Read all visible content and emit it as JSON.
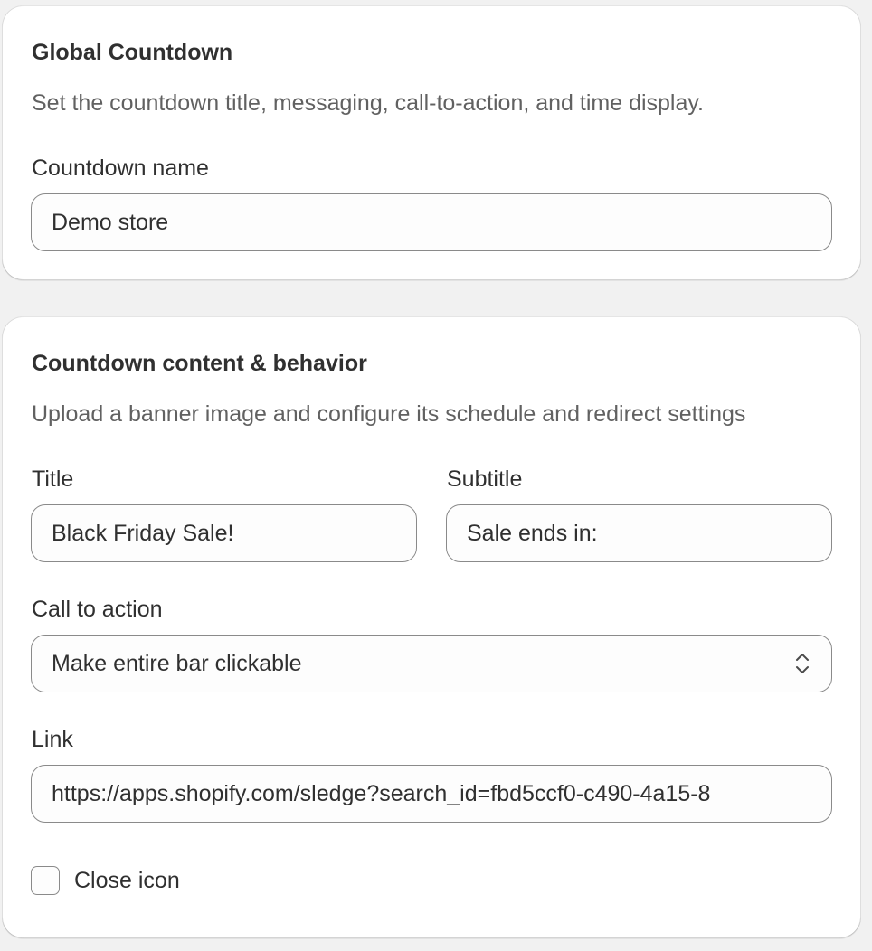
{
  "global_card": {
    "title": "Global Countdown",
    "description": "Set the countdown title, messaging, call-to-action, and time display.",
    "name_label": "Countdown name",
    "name_value": "Demo store"
  },
  "content_card": {
    "title": "Countdown content & behavior",
    "description": "Upload a banner image and configure its schedule and redirect settings",
    "title_label": "Title",
    "title_value": "Black Friday Sale!",
    "subtitle_label": "Subtitle",
    "subtitle_value": "Sale ends in:",
    "cta_label": "Call to action",
    "cta_value": "Make entire bar clickable",
    "cta_icon": "select-chevrons-icon",
    "link_label": "Link",
    "link_value": "https://apps.shopify.com/sledge?search_id=fbd5ccf0-c490-4a15-8",
    "close_icon_label": "Close icon",
    "close_icon_checked": false
  }
}
